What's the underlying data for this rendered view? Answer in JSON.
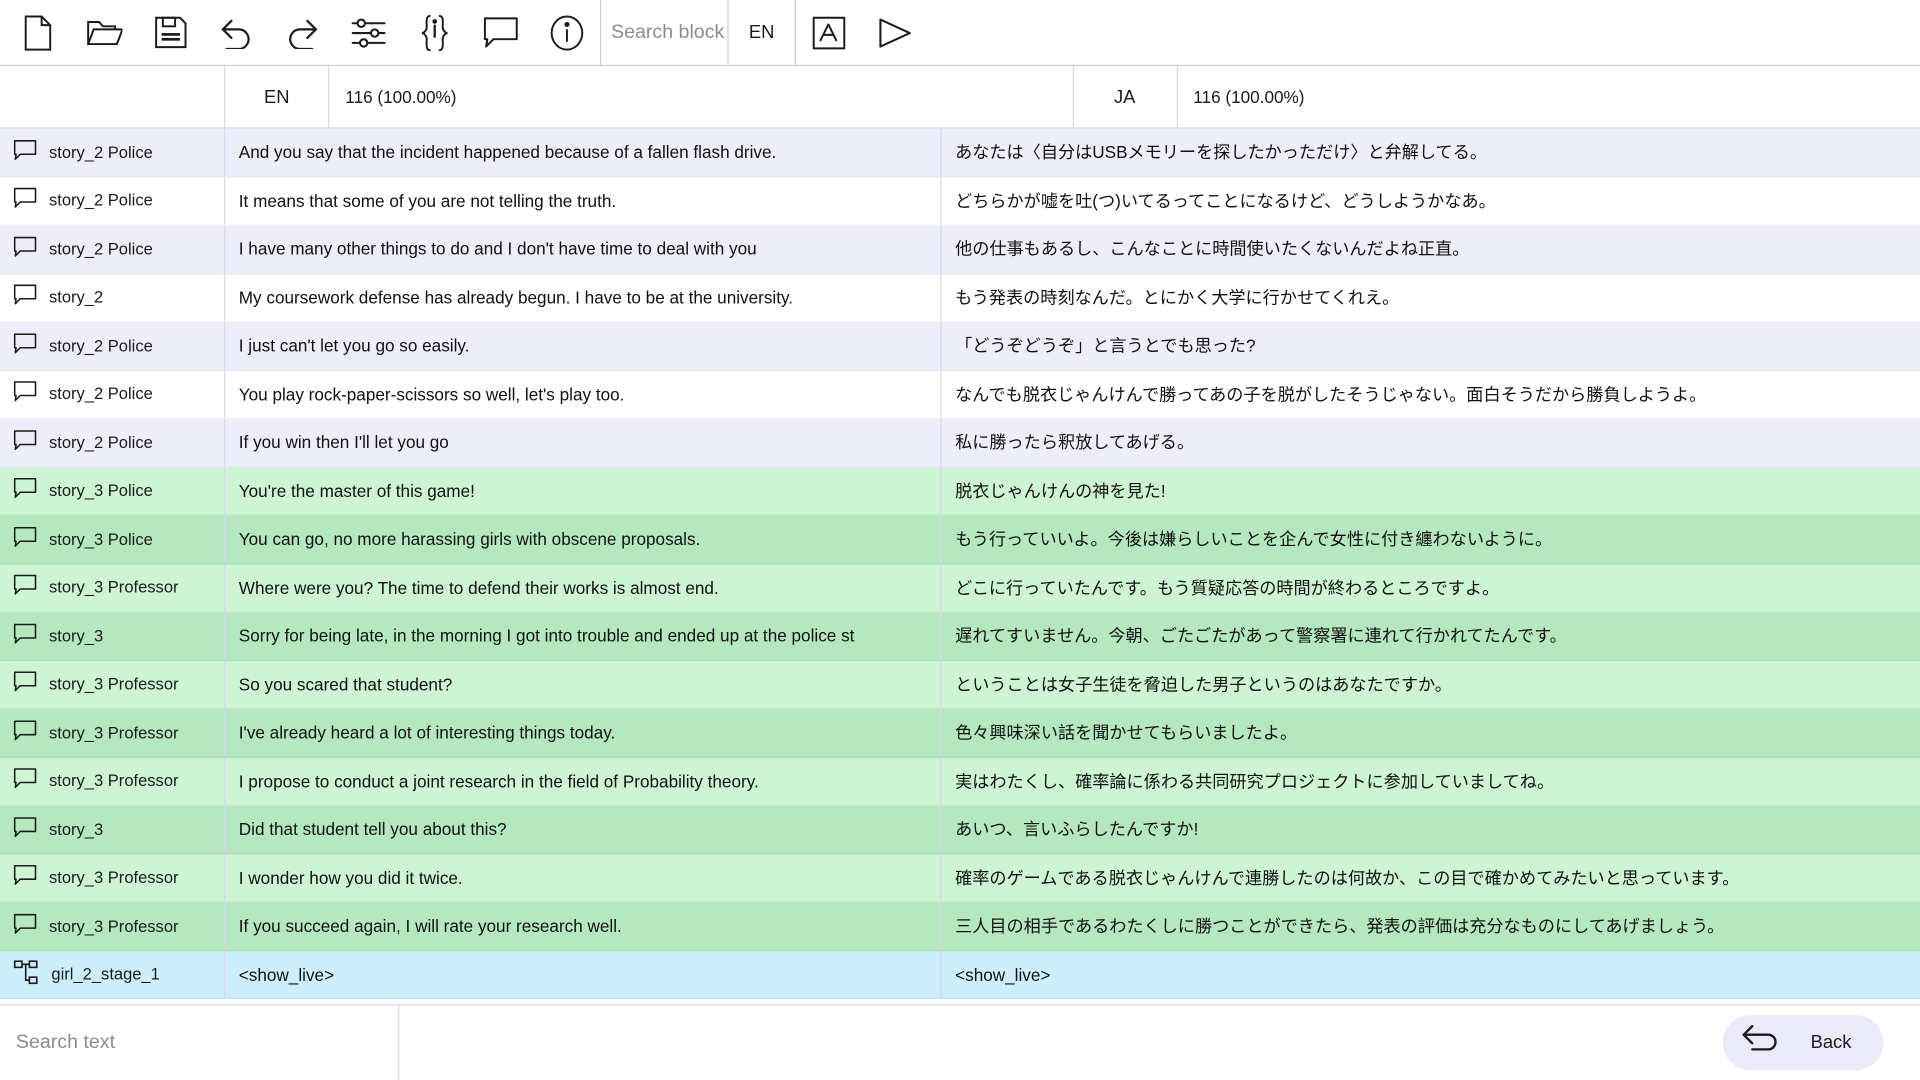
{
  "toolbar": {
    "buttons": [
      {
        "name": "new-file-icon",
        "label": "New"
      },
      {
        "name": "open-folder-icon",
        "label": "Open"
      },
      {
        "name": "save-disk-icon",
        "label": "Save"
      },
      {
        "name": "undo-icon",
        "label": "Undo"
      },
      {
        "name": "redo-icon",
        "label": "Redo"
      },
      {
        "name": "settings-sliders-icon",
        "label": "Settings"
      },
      {
        "name": "json-braces-icon",
        "label": "JSON"
      },
      {
        "name": "comment-bubble-icon",
        "label": "Comment"
      },
      {
        "name": "info-icon",
        "label": "Info"
      }
    ],
    "search_placeholder": "Search block",
    "language": "EN",
    "right_buttons": [
      {
        "name": "translate-icon",
        "label": "Translate"
      },
      {
        "name": "play-triangle-icon",
        "label": "Run"
      }
    ]
  },
  "header": {
    "key_column": "",
    "source_lang": "EN",
    "source_count": "116 (100.00%)",
    "target_lang": "JA",
    "target_count": "116 (100.00%)"
  },
  "bottom": {
    "search_placeholder": "Search text",
    "back_label": "Back",
    "back_icon": "undo-arrow-icon"
  },
  "colors": {
    "lavender_odd": "#eeeefb",
    "lavender_even": "#ffffff",
    "green_light": "#cdf5d3",
    "green_dark": "#b5e8bf",
    "blue": "#cdeefb",
    "border": "#d6d6ef"
  },
  "rows": [
    {
      "icon": "comment-bubble-icon",
      "key": "story_2 Police",
      "source": "And you say that the incident happened because of a fallen flash drive.",
      "target": "あなたは〈自分はUSBメモリーを探したかっただけ〉と弁解してる。",
      "variant": "v-lav-a"
    },
    {
      "icon": "comment-bubble-icon",
      "key": "story_2 Police",
      "source": "It means that some of you are not telling the truth.",
      "target": "どちらかが嘘を吐(つ)いてるってことになるけど、どうしようかなあ。",
      "variant": "v-lav-b"
    },
    {
      "icon": "comment-bubble-icon",
      "key": "story_2 Police",
      "source": "I have many other things to do and I don't have time to deal with you",
      "target": "他の仕事もあるし、こんなことに時間使いたくないんだよね正直。",
      "variant": "v-lav-a"
    },
    {
      "icon": "comment-bubble-icon",
      "key": "story_2",
      "source": "My coursework defense has already begun. I have to be at the university.",
      "target": "もう発表の時刻なんだ。とにかく大学に行かせてくれえ。",
      "variant": "v-lav-b"
    },
    {
      "icon": "comment-bubble-icon",
      "key": "story_2 Police",
      "source": "I just can't let you go so easily.",
      "target": "「どうぞどうぞ」と言うとでも思った?",
      "variant": "v-lav-a"
    },
    {
      "icon": "comment-bubble-icon",
      "key": "story_2 Police",
      "source": "You play rock-paper-scissors so well, let's play too.",
      "target": "なんでも脱衣じゃんけんで勝ってあの子を脱がしたそうじゃない。面白そうだから勝負しようよ。",
      "variant": "v-lav-b"
    },
    {
      "icon": "comment-bubble-icon",
      "key": "story_2 Police",
      "source": "If you win then I'll let you go",
      "target": "私に勝ったら釈放してあげる。",
      "variant": "v-lav-a"
    },
    {
      "icon": "comment-bubble-icon",
      "key": "story_3 Police",
      "source": "You're the master of this game!",
      "target": "脱衣じゃんけんの神を見た!",
      "variant": "v-grn-a"
    },
    {
      "icon": "comment-bubble-icon",
      "key": "story_3 Police",
      "source": "You can go, no more harassing girls with obscene proposals.",
      "target": "もう行っていいよ。今後は嫌らしいことを企んで女性に付き纏わないように。",
      "variant": "v-grn-b"
    },
    {
      "icon": "comment-bubble-icon",
      "key": "story_3 Professor",
      "source": "Where were you? The time to defend their works is almost end.",
      "target": "どこに行っていたんです。もう質疑応答の時間が終わるところですよ。",
      "variant": "v-grn-a"
    },
    {
      "icon": "comment-bubble-icon",
      "key": "story_3",
      "source": "Sorry for being late, in the morning I got into trouble and ended up at the police st",
      "target": "遅れてすいません。今朝、ごたごたがあって警察署に連れて行かれてたんです。",
      "variant": "v-grn-b"
    },
    {
      "icon": "comment-bubble-icon",
      "key": "story_3 Professor",
      "source": "So you scared that student?",
      "target": "ということは女子生徒を脅迫した男子というのはあなたですか。",
      "variant": "v-grn-a"
    },
    {
      "icon": "comment-bubble-icon",
      "key": "story_3 Professor",
      "source": "I've already heard a lot of interesting things today.",
      "target": "色々興味深い話を聞かせてもらいましたよ。",
      "variant": "v-grn-b"
    },
    {
      "icon": "comment-bubble-icon",
      "key": "story_3 Professor",
      "source": "I propose to conduct a joint research in the field of Probability theory.",
      "target": "実はわたくし、確率論に係わる共同研究プロジェクトに参加していましてね。",
      "variant": "v-grn-a"
    },
    {
      "icon": "comment-bubble-icon",
      "key": "story_3",
      "source": "Did that student tell you about this?",
      "target": "あいつ、言いふらしたんですか!",
      "variant": "v-grn-b"
    },
    {
      "icon": "comment-bubble-icon",
      "key": "story_3 Professor",
      "source": "I wonder how you did it twice.",
      "target": "確率のゲームである脱衣じゃんけんで連勝したのは何故か、この目で確かめてみたいと思っています。",
      "variant": "v-grn-a"
    },
    {
      "icon": "comment-bubble-icon",
      "key": "story_3 Professor",
      "source": "If you succeed again, I will rate your research well.",
      "target": "三人目の相手であるわたくしに勝つことができたら、発表の評価は充分なものにしてあげましょう。",
      "variant": "v-grn-b"
    },
    {
      "icon": "node-tree-icon",
      "key": "girl_2_stage_1",
      "source": "<show_live>",
      "target": "<show_live>",
      "variant": "v-blue"
    }
  ]
}
